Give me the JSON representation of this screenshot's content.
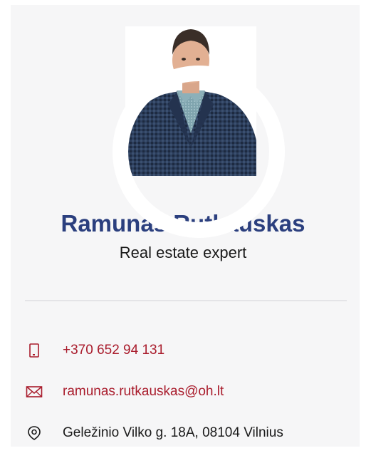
{
  "profile": {
    "name": "Ramunas Rutkauskas",
    "title": "Real estate expert"
  },
  "contacts": {
    "phone": "+370 652 94 131",
    "email": "ramunas.rutkauskas@oh.lt",
    "address": "Geležinio Vilko g. 18A, 08104 Vilnius"
  },
  "icons": {
    "phone": "phone-icon",
    "email": "envelope-icon",
    "address": "location-pin-icon"
  },
  "colors": {
    "name": "#2b3f7e",
    "link": "#a91c2c",
    "card_background": "#f6f6f7"
  }
}
